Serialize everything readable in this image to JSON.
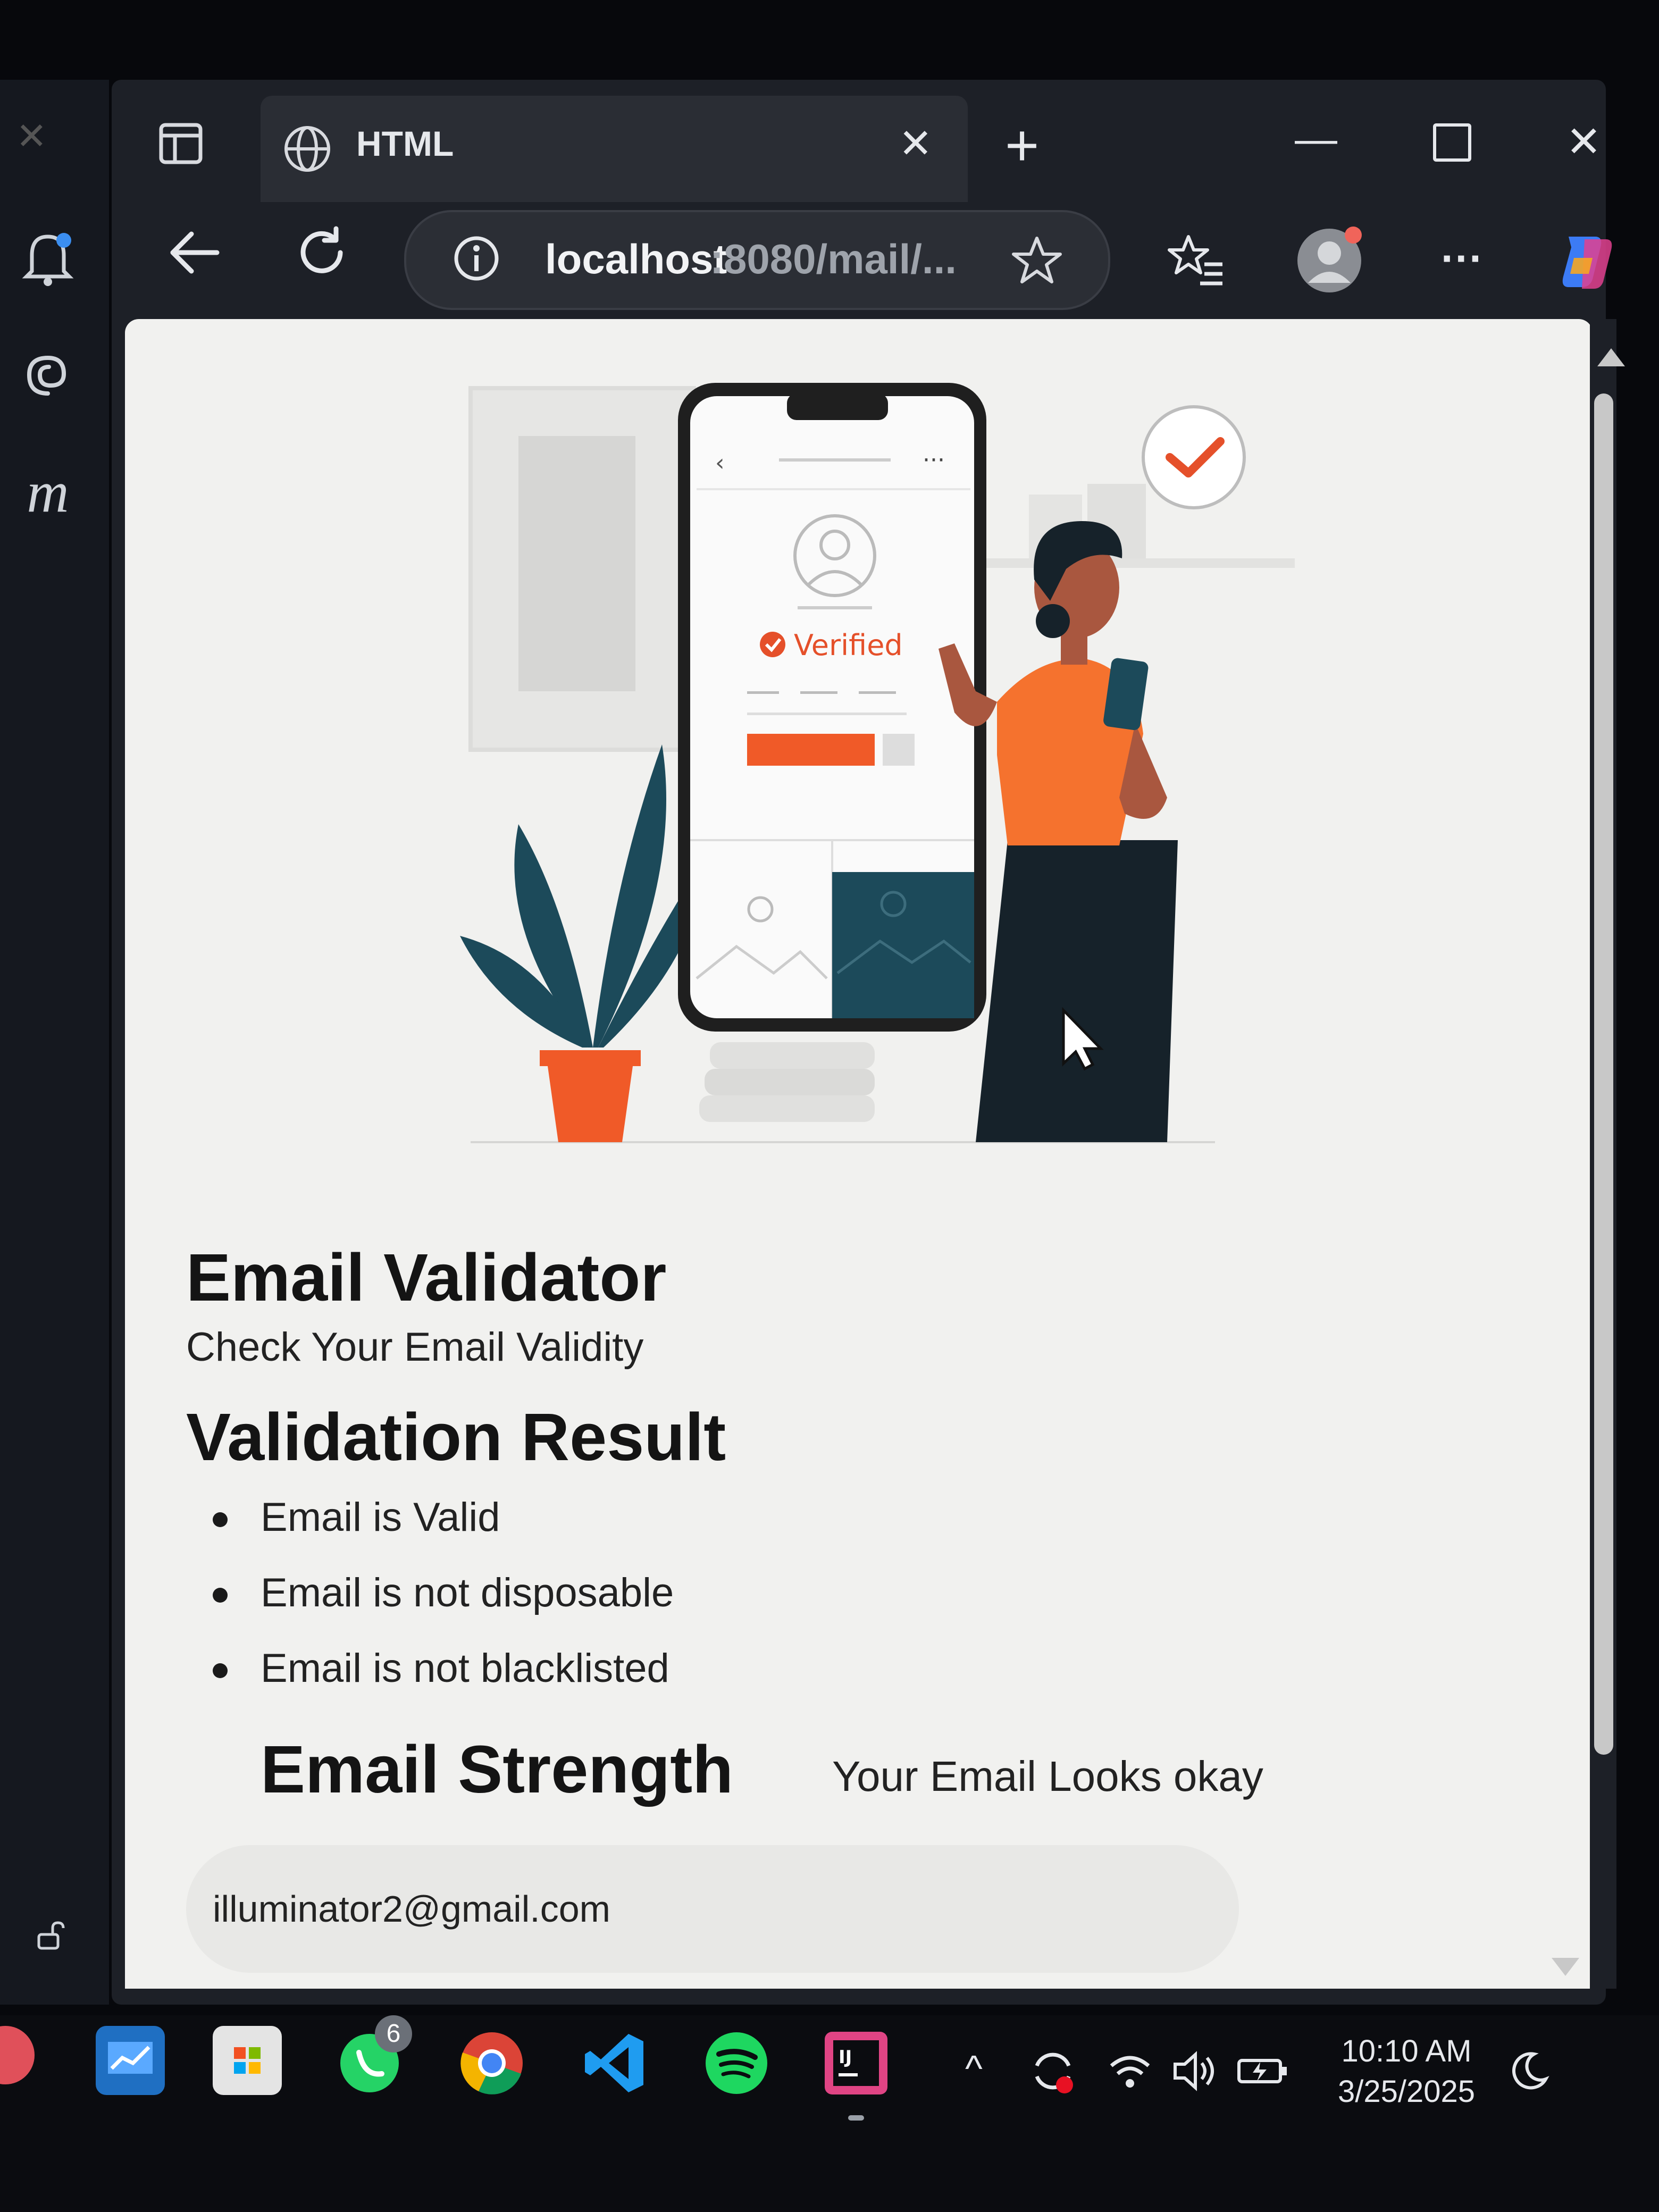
{
  "browser": {
    "tab_title": "HTML",
    "url_host": "localhost",
    "url_path": ":8080/mail/..."
  },
  "illustration": {
    "badge_text": "Verified"
  },
  "page": {
    "title": "Email Validator",
    "subtitle": "Check Your Email Validity",
    "result_heading": "Validation Result",
    "results": [
      "Email is Valid",
      "Email is not disposable",
      "Email is not blacklisted"
    ],
    "strength_heading": "Email Strength",
    "strength_message": "Your Email Looks okay",
    "email_value": "illuminator2@gmail.com"
  },
  "taskbar": {
    "whatsapp_badge": "6",
    "time": "10:10 AM",
    "date": "3/25/2025"
  },
  "colors": {
    "accent_orange": "#f05a28",
    "teal": "#1c4a5a"
  }
}
